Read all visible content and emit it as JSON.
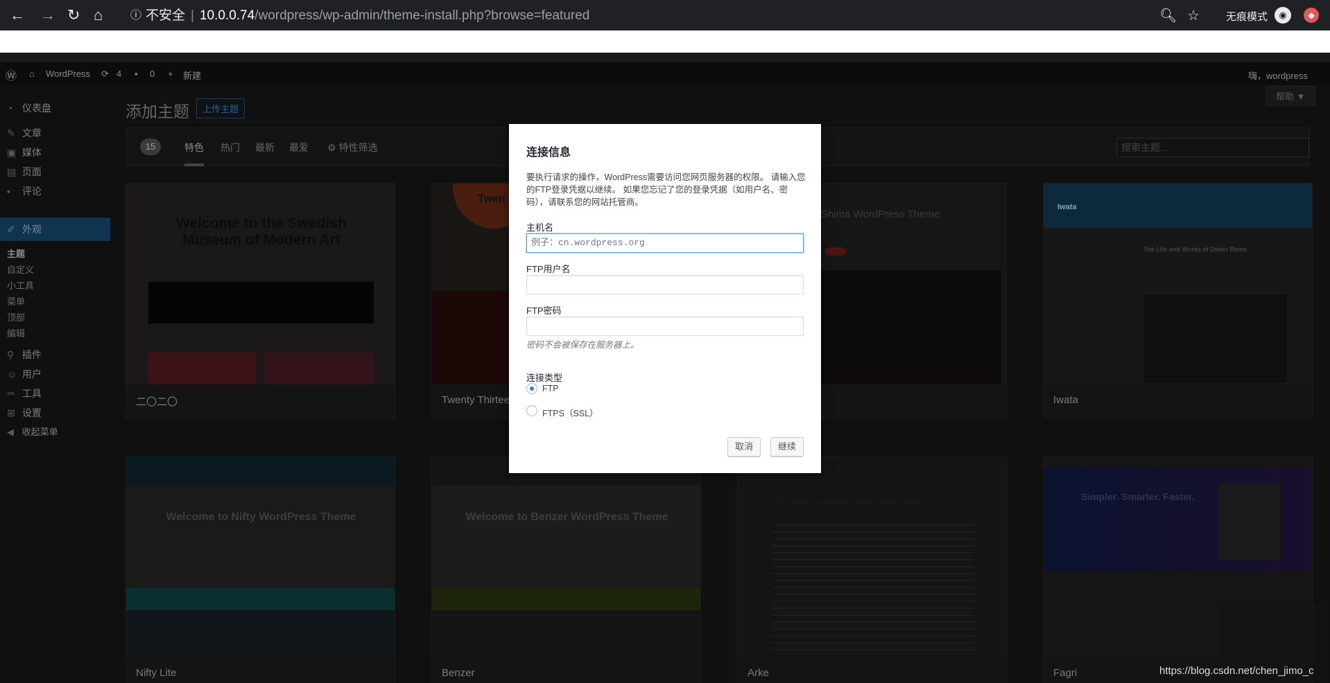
{
  "browser": {
    "back": "←",
    "forward": "→",
    "reload": "↻",
    "home": "⌂",
    "insecure_label": "不安全",
    "host": "10.0.0.74",
    "path": "/wordpress/wp-admin/theme-install.php?browse=featured",
    "zoom_icon": "zoom-icon",
    "star_icon": "star-icon",
    "incognito_label": "无痕模式"
  },
  "adminbar": {
    "site_name": "WordPress",
    "updates_count": "4",
    "comments_count": "0",
    "new_label": "新建",
    "greeting": "嗨，wordpress"
  },
  "sidebar": {
    "items": [
      {
        "icon": "dashboard-icon",
        "label": "仪表盘"
      },
      {
        "icon": "pin-icon",
        "label": "文章"
      },
      {
        "icon": "media-icon",
        "label": "媒体"
      },
      {
        "icon": "page-icon",
        "label": "页面"
      },
      {
        "icon": "comment-icon",
        "label": "评论"
      },
      {
        "icon": "brush-icon",
        "label": "外观"
      },
      {
        "icon": "plugin-icon",
        "label": "插件"
      },
      {
        "icon": "user-icon",
        "label": "用户"
      },
      {
        "icon": "wrench-icon",
        "label": "工具"
      },
      {
        "icon": "settings-icon",
        "label": "设置"
      },
      {
        "icon": "collapse-icon",
        "label": "收起菜单"
      }
    ],
    "submenu": [
      "主题",
      "自定义",
      "小工具",
      "菜单",
      "顶部",
      "编辑"
    ]
  },
  "content": {
    "title": "添加主题",
    "upload_label": "上传主题",
    "help_label": "帮助 ▼",
    "theme_count": "15",
    "tabs": [
      "特色",
      "热门",
      "最新",
      "最爱",
      "特性筛选"
    ],
    "search_placeholder": "搜索主题...",
    "themes": [
      {
        "name": "二〇二〇",
        "heading": "Welcome to the Swedish Museum of Modern Art"
      },
      {
        "name": "Twenty Thirteen",
        "heading": "Twen"
      },
      {
        "name": "",
        "heading": "Shima WordPress Theme"
      },
      {
        "name": "Iwata",
        "heading": "The Life and Works of Dieter Rams"
      },
      {
        "name": "Nifty Lite",
        "heading": "Welcome to Nifty WordPress Theme"
      },
      {
        "name": "Benzer",
        "heading": "Welcome to Benzer WordPress Theme"
      },
      {
        "name": "Arke",
        "heading": "To Create a Habit, Tell a Good Story"
      },
      {
        "name": "Fagri",
        "heading": "Simpler. Smarter. Faster."
      }
    ]
  },
  "modal": {
    "title": "连接信息",
    "description": "要执行请求的操作，WordPress需要访问您网页服务器的权限。 请输入您的FTP登录凭据以继续。 如果您忘记了您的登录凭据（如用户名、密码），请联系您的网站托管商。",
    "hostname_label": "主机名",
    "hostname_placeholder": "例子：cn.wordpress.org",
    "username_label": "FTP用户名",
    "password_label": "FTP密码",
    "password_note": "密码不会被保存在服务器上。",
    "conn_type_label": "连接类型",
    "opt_ftp": "FTP",
    "opt_ftps": "FTPS（SSL）",
    "cancel_label": "取消",
    "continue_label": "继续"
  },
  "watermark": "https://blog.csdn.net/chen_jimo_c"
}
